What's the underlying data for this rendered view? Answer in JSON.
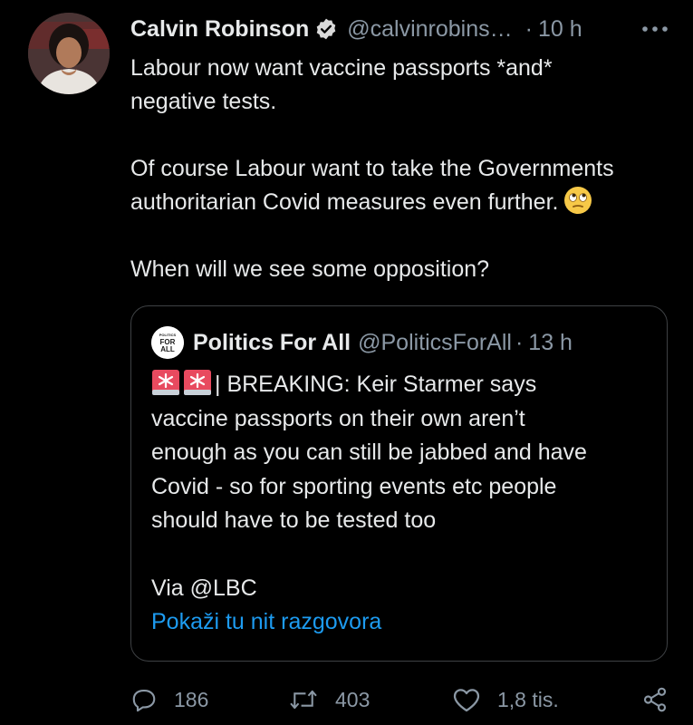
{
  "tweet": {
    "author": {
      "display_name": "Calvin Robinson",
      "handle": "@calvinrobins…",
      "verified": true
    },
    "time": "10 h",
    "text": {
      "p1_line1": "Labour now want vaccine passports *and*",
      "p1_line2": "negative tests.",
      "p2_line1": "Of course Labour want to take the Governments",
      "p2_line2": "authoritarian Covid measures even further.",
      "p3": "When will we see some opposition?"
    },
    "emoji": "face-with-rolling-eyes"
  },
  "quoted": {
    "author": {
      "display_name": "Politics For All",
      "handle": "@PoliticsForAll",
      "logo_small": "POLITICS",
      "logo_big1": "FOR",
      "logo_big2": "ALL"
    },
    "dot": "·",
    "time": "13 h",
    "text": {
      "line1": "| BREAKING: Keir Starmer says",
      "line2": "vaccine passports on their own aren’t",
      "line3": "enough as you can still be jabbed and have",
      "line4": "Covid - so for sporting events etc people",
      "line5": "should have to be tested too",
      "line6": "Via @LBC"
    },
    "show_thread": "Pokaži tu nit razgovora"
  },
  "actions": {
    "replies": "186",
    "retweets": "403",
    "likes": "1,8 tis."
  },
  "colors": {
    "background": "#000000",
    "text": "#e7e9ea",
    "secondary": "#8b98a5",
    "link": "#1d9bf0",
    "border": "#3e4144"
  }
}
